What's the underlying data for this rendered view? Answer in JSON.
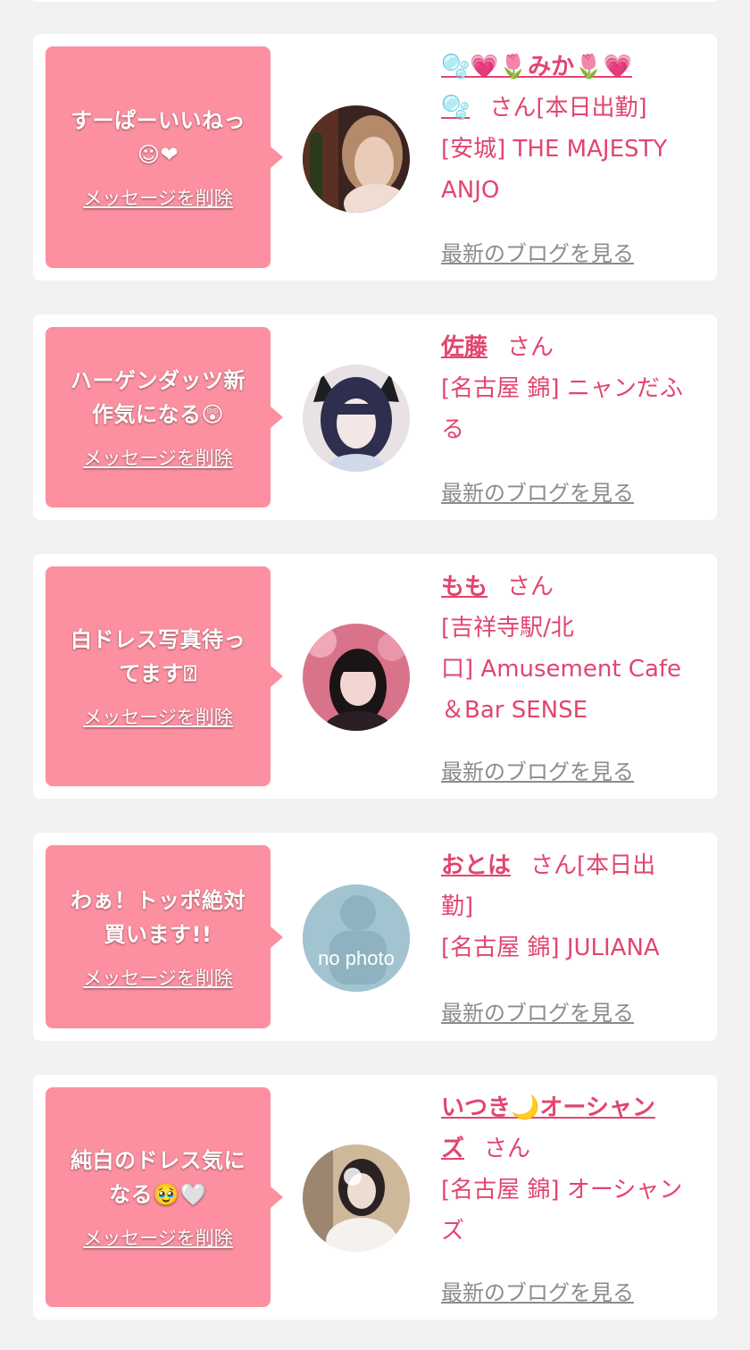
{
  "cards": [
    {
      "message_line1": "すーぱーいいねっ",
      "message_line2": "☺❤",
      "delete_label": "メッセージを削除",
      "name_line1": "🫧💗🌷みか🌷💗",
      "name_line2": "🫧",
      "san_label": "さん[本日出勤]",
      "shop_line1": "[安城] THE MAJESTY",
      "shop_line2": "ANJO",
      "blog_label": "最新のブログを見る"
    },
    {
      "message_line1": "ハーゲンダッツ新",
      "message_line2": "作気になる😲",
      "delete_label": "メッセージを削除",
      "name": "佐藤",
      "san_label": "さん",
      "shop_line1": "[名古屋 錦] ニャンだふ",
      "shop_line2": "る",
      "blog_label": "最新のブログを見る"
    },
    {
      "message_line1": "白ドレス写真待っ",
      "message_line2": "てます⍰",
      "delete_label": "メッセージを削除",
      "name": "もも",
      "san_label": "さん",
      "shop_line1": "[吉祥寺駅/北",
      "shop_line2": "口] Amusement Cafe",
      "shop_line3": "＆Bar SENSE",
      "blog_label": "最新のブログを見る"
    },
    {
      "message_line1": "わぁ！トッポ絶対",
      "message_line2": "買います!!",
      "delete_label": "メッセージを削除",
      "name": "おとは",
      "san_label": "さん[本日出",
      "san_line2": "勤]",
      "shop_line1": "[名古屋 錦] JULIANA",
      "avatar_text": "no photo",
      "blog_label": "最新のブログを見る"
    },
    {
      "message_line1": "純白のドレス気に",
      "message_line2": "なる🥹🤍",
      "delete_label": "メッセージを削除",
      "name_line1": "いつき🌙オーシャン",
      "name_line2": "ズ",
      "san_label": "さん",
      "shop_line1": "[名古屋 錦] オーシャン",
      "shop_line2": "ズ",
      "blog_label": "最新のブログを見る"
    }
  ],
  "colors": {
    "page_bg": "#f2f2f2",
    "card_bg": "#ffffff",
    "bubble_pink": "#fc8fa0",
    "accent_text": "#e2456f",
    "link_gray": "#8c8c8c"
  }
}
